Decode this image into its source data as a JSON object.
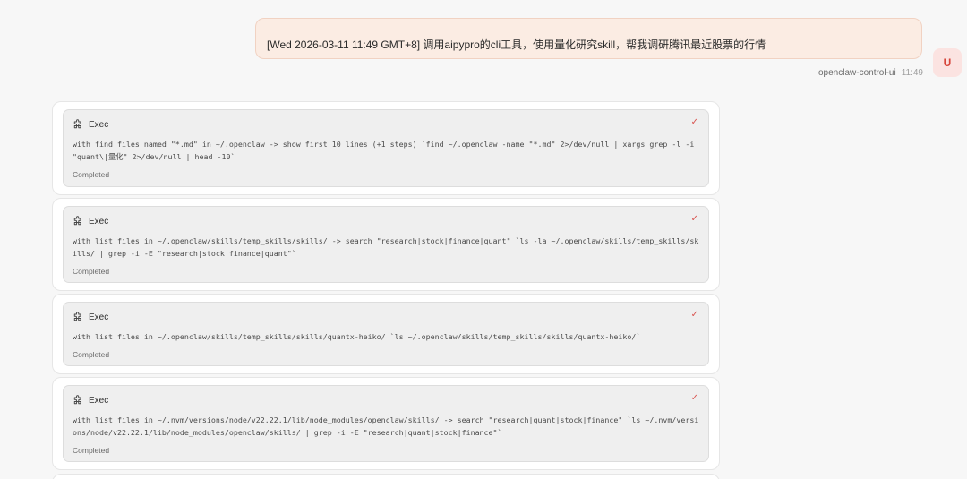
{
  "user_message": {
    "text": "[Wed 2026-03-11 11:49 GMT+8] 调用aipypro的cli工具，使用量化研究skill，帮我调研腾讯最近股票的行情",
    "sender": "openclaw-control-ui",
    "time": "11:49",
    "avatar_letter": "U"
  },
  "tool_calls": [
    {
      "name": "Exec",
      "command": "with find files named \"*.md\" in ~/.openclaw -> show first 10 lines (+1 steps) `find ~/.openclaw -name \"*.md\" 2>/dev/null | xargs grep -l -i \"quant\\|量化\" 2>/dev/null | head -10`",
      "status": "Completed"
    },
    {
      "name": "Exec",
      "command": "with list files in ~/.openclaw/skills/temp_skills/skills/ -> search \"research|stock|finance|quant\" `ls -la ~/.openclaw/skills/temp_skills/skills/ | grep -i -E \"research|stock|finance|quant\"`",
      "status": "Completed"
    },
    {
      "name": "Exec",
      "command": "with list files in ~/.openclaw/skills/temp_skills/skills/quantx-heiko/ `ls ~/.openclaw/skills/temp_skills/skills/quantx-heiko/`",
      "status": "Completed"
    },
    {
      "name": "Exec",
      "command": "with list files in ~/.nvm/versions/node/v22.22.1/lib/node_modules/openclaw/skills/ -> search \"research|quant|stock|finance\" `ls ~/.nvm/versions/node/v22.22.1/lib/node_modules/openclaw/skills/ | grep -i -E \"research|quant|stock|finance\"`",
      "status": "Completed"
    }
  ],
  "icons": {
    "tool": "puzzle-icon",
    "status": "check-icon"
  },
  "colors": {
    "user_bubble_bg": "#fbece3",
    "avatar_text": "#d6453a",
    "check": "#d9534f"
  }
}
